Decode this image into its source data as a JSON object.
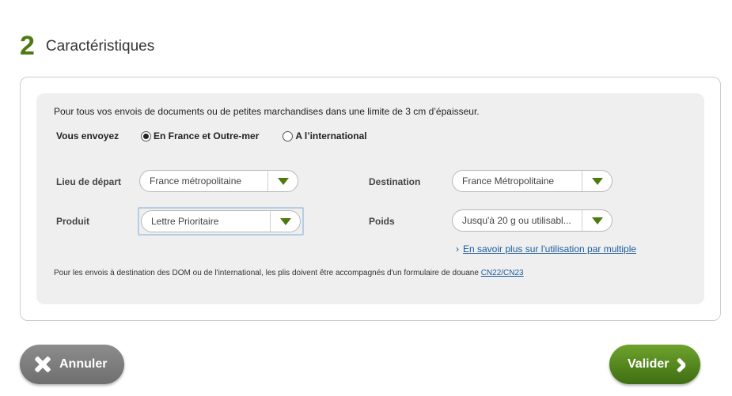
{
  "step": {
    "number": "2",
    "title": "Caractéristiques"
  },
  "form": {
    "intro": "Pour tous vos envois de documents ou de petites marchandises dans une limite de 3 cm d’épaisseur.",
    "send_label": "Vous envoyez",
    "radio_options": [
      {
        "label": "En France et Outre-mer",
        "checked": true
      },
      {
        "label": "A l’international",
        "checked": false
      }
    ],
    "departure": {
      "label": "Lieu de départ",
      "value": "France métropolitaine"
    },
    "destination": {
      "label": "Destination",
      "value": "France Métropolitaine"
    },
    "product": {
      "label": "Produit",
      "value": "Lettre Prioritaire"
    },
    "weight": {
      "label": "Poids",
      "value": "Jusqu'à 20 g ou utilisabl..."
    },
    "more_link": "En savoir plus sur l'utilisation par multiple",
    "note_text": "Pour les envois à destination des DOM ou de l'international, les plis doivent être accompagnés d'un formulaire de douane ",
    "note_link": "CN22/CN23"
  },
  "buttons": {
    "cancel": "Annuler",
    "validate": "Valider"
  },
  "colors": {
    "accent_green": "#4d7a12",
    "link_blue": "#1a5c9c",
    "panel_gray": "#efefef"
  },
  "icons": {
    "select_arrow": "triangle-down-icon",
    "cancel": "close-icon",
    "validate": "chevron-right-icon",
    "link": "chevron-right-icon"
  }
}
